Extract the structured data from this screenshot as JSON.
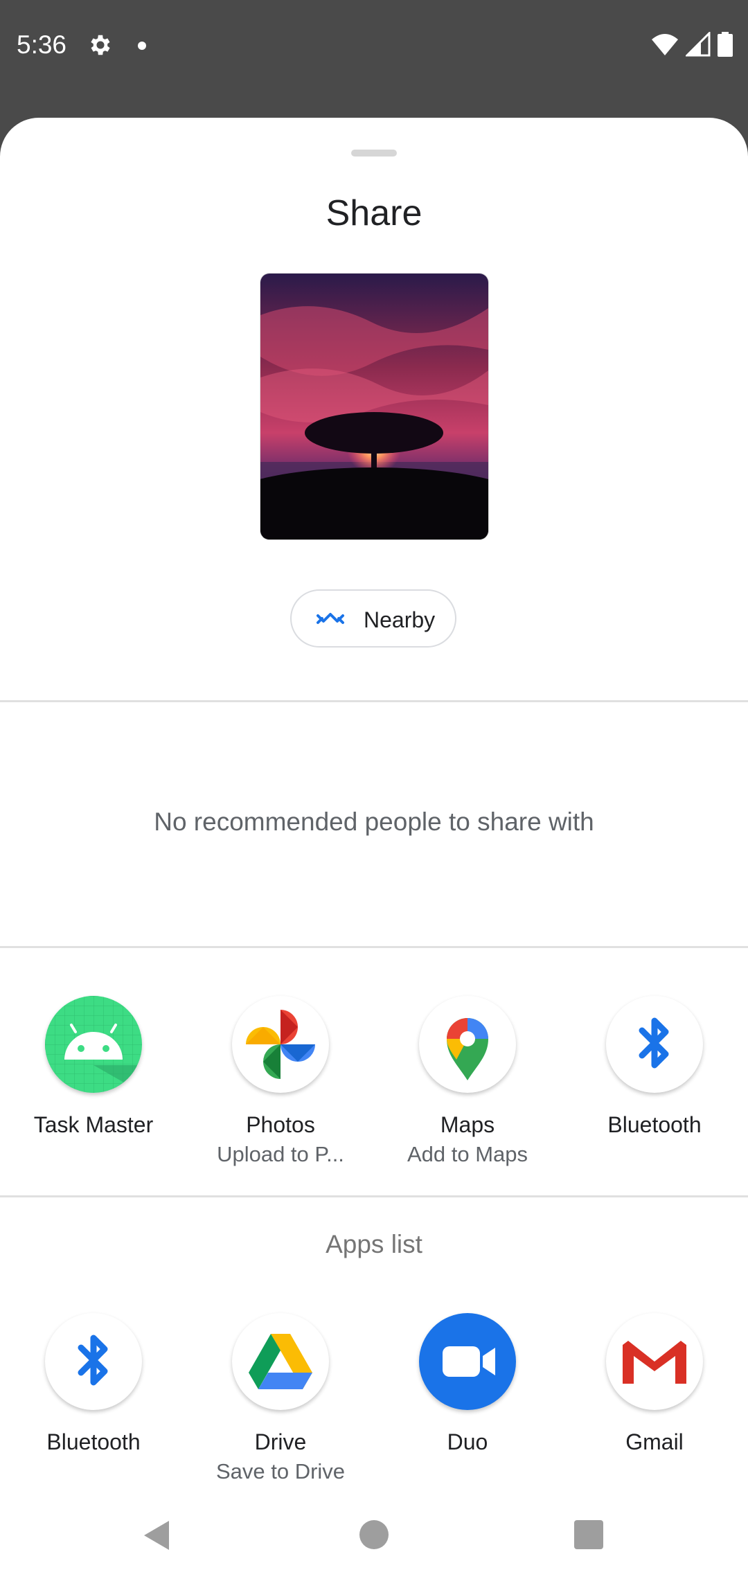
{
  "status_bar": {
    "time": "5:36",
    "icons": [
      "gear-icon",
      "notification-dot-icon",
      "wifi-icon",
      "cell-signal-icon",
      "battery-icon"
    ]
  },
  "sheet": {
    "title": "Share",
    "preview_image": "sunset-tree-photo",
    "nearby_label": "Nearby",
    "no_people_message": "No recommended people to share with",
    "apps_list_title": "Apps list"
  },
  "direct_share_apps": [
    {
      "label": "Task Master",
      "sub": "",
      "icon": "android-icon"
    },
    {
      "label": "Photos",
      "sub": "Upload to P...",
      "icon": "photos-pinwheel-icon"
    },
    {
      "label": "Maps",
      "sub": "Add to Maps",
      "icon": "maps-pin-icon"
    },
    {
      "label": "Bluetooth",
      "sub": "",
      "icon": "bluetooth-icon"
    }
  ],
  "apps_list": [
    {
      "label": "Bluetooth",
      "sub": "",
      "icon": "bluetooth-icon"
    },
    {
      "label": "Drive",
      "sub": "Save to Drive",
      "icon": "drive-icon"
    },
    {
      "label": "Duo",
      "sub": "",
      "icon": "duo-video-icon"
    },
    {
      "label": "Gmail",
      "sub": "",
      "icon": "gmail-icon"
    }
  ],
  "colors": {
    "status_bar_bg": "#4a4a4a",
    "accent_blue": "#1a73e8",
    "text_primary": "#202124",
    "text_secondary": "#5f6368"
  }
}
